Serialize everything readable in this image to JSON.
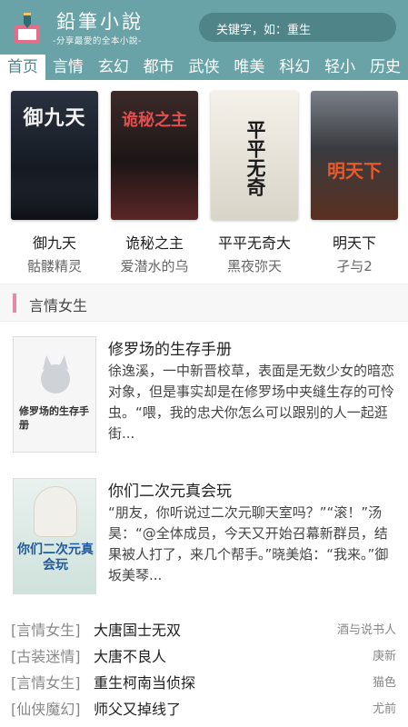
{
  "header": {
    "logo_title": "鉛筆小說",
    "logo_slogan": "-分享最愛的全本小說-",
    "search_placeholder": "关键字，如：重生"
  },
  "nav": [
    "首页",
    "言情",
    "玄幻",
    "都市",
    "武侠",
    "唯美",
    "科幻",
    "轻小",
    "历史"
  ],
  "featured": [
    {
      "title": "御九天",
      "author": "骷髅精灵",
      "cover_text": "御九天",
      "cover_color": "#1f2530"
    },
    {
      "title": "诡秘之主",
      "author": "爱潜水的乌",
      "cover_text": "诡秘之主",
      "cover_color": "#2b2020"
    },
    {
      "title": "平平无奇大",
      "author": "黑夜弥天",
      "cover_text": "平平无奇",
      "cover_color": "#e9e4d8"
    },
    {
      "title": "明天下",
      "author": "孑与2",
      "cover_text": "明天下",
      "cover_color": "#3a3b40"
    }
  ],
  "section": {
    "title": "言情女生",
    "accent": "#e38aa7"
  },
  "books": [
    {
      "title": "修罗场的生存手册",
      "desc": "徐逸溪，一中新晋校草，表面是无数少女的暗恋对象，但是事实却是在修罗场中夹缝生存的可怜虫。“喂，我的忠犬你怎么可以跟别的人一起逛街...",
      "cover_text": "修罗场的生存手册"
    },
    {
      "title": "你们二次元真会玩",
      "desc": "“朋友，你听说过二次元聊天室吗？”“滚！”汤昊：“@全体成员，今天又开始召幕新群员，结果被人打了，来几个帮手。”晓美焰：“我来。”御坂美琴...",
      "cover_text": "你们二次元真会玩"
    }
  ],
  "list": [
    {
      "category": "[言情女生]",
      "title": "大唐国士无双",
      "author": "酒与说书人"
    },
    {
      "category": "[古装迷情]",
      "title": "大唐不良人",
      "author": "庚新"
    },
    {
      "category": "[言情女生]",
      "title": "重生柯南当侦探",
      "author": "猫色"
    },
    {
      "category": "[仙侠魔幻]",
      "title": "师父又掉线了",
      "author": "尤前"
    }
  ],
  "colors": {
    "header": "#6aa3a7",
    "search": "#4f8589"
  }
}
